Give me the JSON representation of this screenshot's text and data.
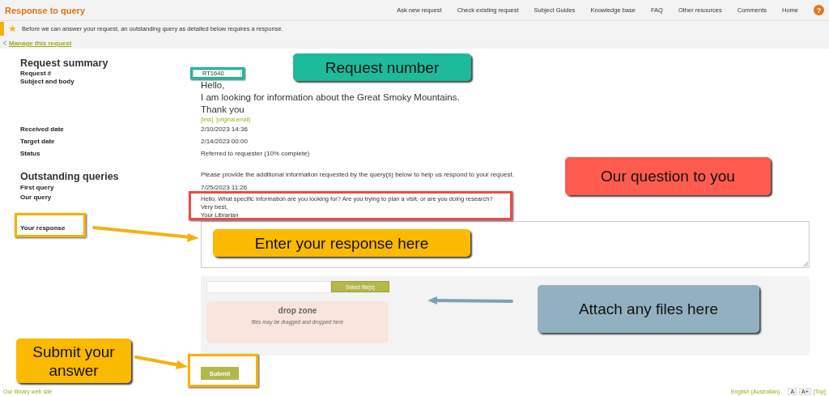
{
  "header": {
    "title": "Response to query",
    "nav": [
      "Ask new request",
      "Check existing request",
      "Subject Guides",
      "Knowledge base",
      "FAQ",
      "Other resources",
      "Comments",
      "Home"
    ],
    "help_icon": "?"
  },
  "notice": {
    "text": "Before we can answer your request, an outstanding query as detailed below requires a response."
  },
  "manage_link": "Manage this request",
  "summary": {
    "heading": "Request summary",
    "request_number": {
      "label": "Request #",
      "value": "RT1640"
    },
    "subject": {
      "label": "Subject and body",
      "lines": [
        "Hello,",
        "I am looking for information about the Great Smoky Mountains.",
        "Thank you"
      ],
      "links": [
        "[less]",
        "[original email]"
      ]
    },
    "rows": [
      {
        "label": "Received date",
        "value": "2/10/2023 14:36"
      },
      {
        "label": "Target date",
        "value": "2/14/2023 00:00"
      },
      {
        "label": "Status",
        "value": "Referred to requester (10% complete)"
      }
    ]
  },
  "outstanding": {
    "heading": "Outstanding queries",
    "intro": "Please provide the additional information requested by the query(s) below to help us respond to your request.",
    "first_query": {
      "label": "First query",
      "value": "7/25/2023 11:26"
    },
    "our_query": {
      "label": "Our query",
      "lines": [
        "Hello, What specific information are you looking for?  Are you trying to plan a visit, or are you doing research?",
        "Very best,",
        "Your Librarian"
      ]
    },
    "response": {
      "label": "Your response"
    }
  },
  "attachment": {
    "button": "Select file(s)",
    "drop_title": "drop zone",
    "drop_hint": "files may be dragged and dropped here"
  },
  "submit": "Submit",
  "footer": {
    "left": "Our library web site",
    "language": "English (Australian)",
    "size_buttons": [
      "A",
      "A+"
    ],
    "top": "[Top]"
  },
  "annotations": {
    "callouts": [
      {
        "text": "Request number",
        "color": "#1dba9c"
      },
      {
        "text": "Our question to you",
        "color": "#ff5b4f"
      },
      {
        "text": "Enter your response here",
        "color": "#fbb900"
      },
      {
        "text": "Attach any files here",
        "color": "#92b0c0"
      },
      {
        "text": "Submit your answer",
        "color": "#fbb900"
      }
    ],
    "frames": [
      {
        "color": "#1dba9c"
      },
      {
        "color": "#ee4b43"
      },
      {
        "color": "#f5b300"
      },
      {
        "color": "#f5b300"
      }
    ],
    "arrows": [
      {
        "color": "#f2b311"
      },
      {
        "color": "#7fa2b6"
      },
      {
        "color": "#f2b311"
      }
    ]
  }
}
